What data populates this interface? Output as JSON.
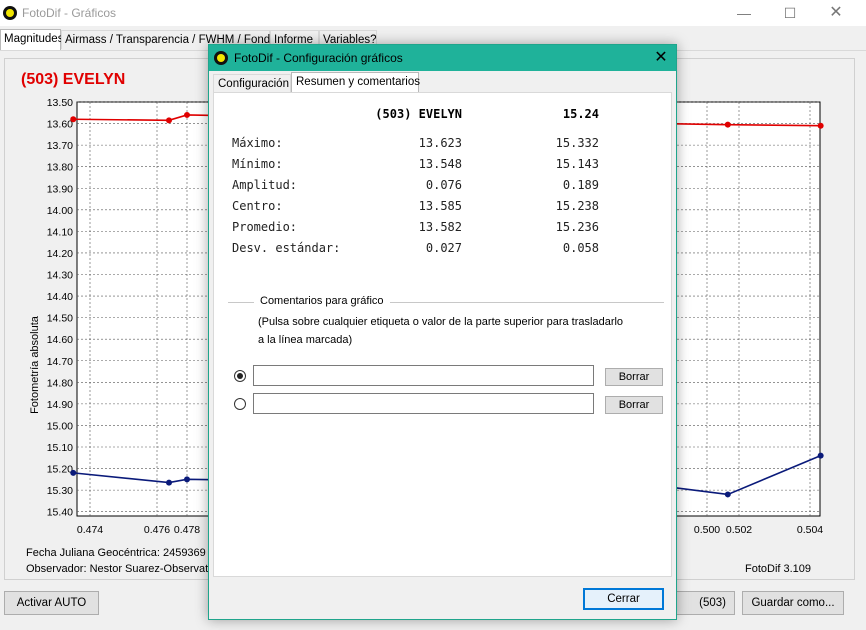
{
  "main_window": {
    "title": "FotoDif - Gráficos",
    "controls": {
      "minimize": "—",
      "maximize": "☐",
      "close": "✕"
    },
    "tabs": [
      {
        "label": "Magnitudes",
        "active": true
      },
      {
        "label": "Airmass / Transparencia / FWHM / Fondo",
        "active": false
      },
      {
        "label": "Informe",
        "active": false
      },
      {
        "label": "Variables?",
        "active": false
      }
    ],
    "buttons": {
      "activar": "Activar AUTO",
      "star": "(503) EVELYN",
      "guardar": "Guardar como..."
    }
  },
  "chart_panel": {
    "star_title": "(503) EVELYN",
    "y_axis_title": "Fotometría absoluta",
    "jd_text": "Fecha Juliana Geocéntrica: 2459369 +",
    "observer_text": "Observador: Nestor Suarez-Observato",
    "version": "FotoDif 3.109"
  },
  "chart_data": {
    "type": "line",
    "y_inverted": true,
    "ylabel": "Fotometría absoluta",
    "y_ticks": [
      "13.50",
      "13.60",
      "13.70",
      "13.80",
      "13.90",
      "14.00",
      "14.10",
      "14.20",
      "14.30",
      "14.40",
      "14.50",
      "14.60",
      "14.70",
      "14.80",
      "14.90",
      "15.00",
      "15.10",
      "15.20",
      "15.30",
      "15.40"
    ],
    "x_ticks": [
      "0.474",
      "0.476",
      "0.478",
      "0.500",
      "0.502",
      "0.504"
    ],
    "ylim": [
      13.5,
      15.42
    ],
    "grid": true,
    "series": [
      {
        "color": "#e00000",
        "points": [
          [
            0.4735,
            13.58
          ],
          [
            0.4768,
            13.585
          ],
          [
            0.478,
            13.56
          ],
          [
            0.498,
            13.6
          ],
          [
            0.5013,
            13.605
          ],
          [
            0.5043,
            13.61
          ]
        ]
      },
      {
        "color": "#0a1a7a",
        "points": [
          [
            0.4735,
            15.22
          ],
          [
            0.4768,
            15.265
          ],
          [
            0.478,
            15.25
          ],
          [
            0.498,
            15.28
          ],
          [
            0.5013,
            15.32
          ],
          [
            0.5043,
            15.14
          ]
        ]
      }
    ]
  },
  "dialog": {
    "title": "FotoDif - Configuración gráficos",
    "close": "✕",
    "tabs": [
      {
        "label": "Configuración",
        "active": false
      },
      {
        "label": "Resumen y comentarios",
        "active": true
      }
    ],
    "summary": {
      "header_star": "(503) EVELYN",
      "header_value": "15.24",
      "rows": [
        {
          "label": "Máximo:",
          "v1": "13.623",
          "v2": "15.332"
        },
        {
          "label": "Mínimo:",
          "v1": "13.548",
          "v2": "15.143"
        },
        {
          "label": "Amplitud:",
          "v1": "0.076",
          "v2": "0.189"
        },
        {
          "label": "Centro:",
          "v1": "13.585",
          "v2": "15.238"
        },
        {
          "label": "Promedio:",
          "v1": "13.582",
          "v2": "15.236"
        },
        {
          "label": "Desv. estándar:",
          "v1": "0.027",
          "v2": "0.058"
        }
      ]
    },
    "comments": {
      "title": "Comentarios para gráfico",
      "help_line1": "(Pulsa sobre cualquier etiqueta o valor de la parte superior para trasladarlo",
      "help_line2": "a la línea marcada)",
      "input1_value": "",
      "input2_value": "",
      "borrar": "Borrar",
      "selected": 1
    },
    "cerrar": "Cerrar"
  }
}
